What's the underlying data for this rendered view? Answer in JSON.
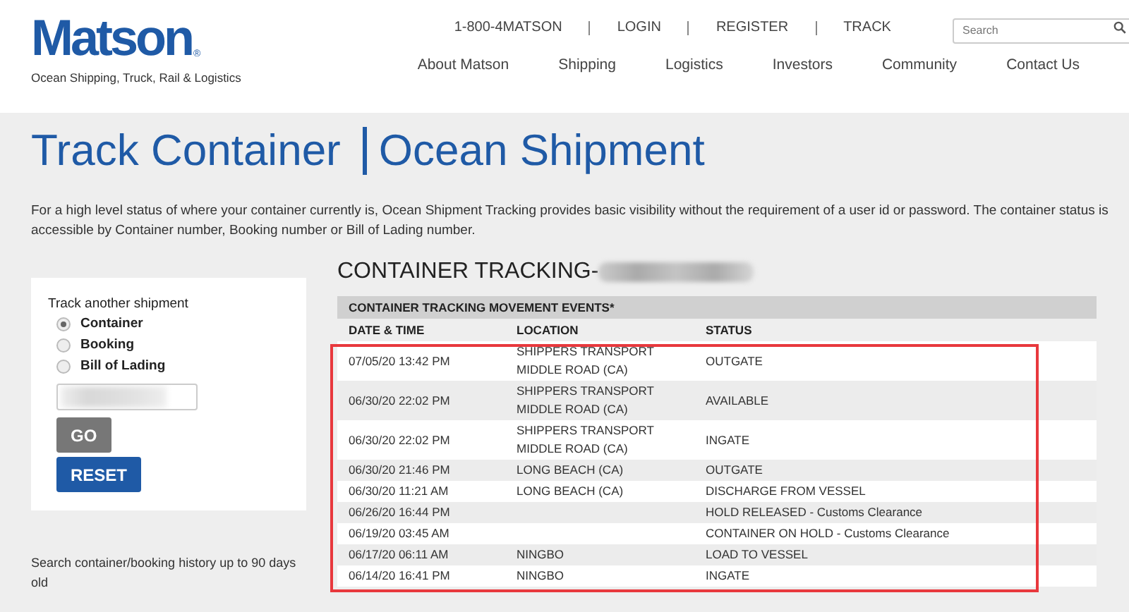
{
  "header": {
    "logo": "Matson",
    "logo_mark": "®",
    "tagline": "Ocean Shipping, Truck, Rail & Logistics",
    "top_links": [
      "1-800-4MATSON",
      "LOGIN",
      "REGISTER",
      "TRACK"
    ],
    "search": {
      "placeholder": "Search"
    },
    "nav": [
      "About Matson",
      "Shipping",
      "Logistics",
      "Investors",
      "Community",
      "Contact Us"
    ]
  },
  "page": {
    "title_left": "Track Container",
    "title_right": "Ocean Shipment",
    "intro": "For a high level status of where your container currently is, Ocean Shipment Tracking provides basic visibility without the requirement of a user id or password. The container status is accessible by Container number, Booking number or Bill of Lading number."
  },
  "tracker": {
    "title": "Track another shipment",
    "options": [
      {
        "label": "Container",
        "selected": true
      },
      {
        "label": "Booking",
        "selected": false
      },
      {
        "label": "Bill of Lading",
        "selected": false
      }
    ],
    "buttons": [
      {
        "label": "GO",
        "kind": "secondary"
      },
      {
        "label": "RESET",
        "kind": "primary"
      }
    ]
  },
  "history_note": "Search container/booking history up to 90 days old",
  "tracking": {
    "heading": "CONTAINER TRACKING-",
    "caption": "CONTAINER TRACKING  MOVEMENT EVENTS*",
    "columns": [
      "DATE & TIME",
      "LOCATION",
      "STATUS"
    ],
    "rows": [
      {
        "date": "07/05/20 13:42 PM",
        "location": "SHIPPERS TRANSPORT MIDDLE ROAD (CA)",
        "status": "OUTGATE"
      },
      {
        "date": "06/30/20 22:02 PM",
        "location": "SHIPPERS TRANSPORT MIDDLE ROAD (CA)",
        "status": "AVAILABLE"
      },
      {
        "date": "06/30/20 22:02 PM",
        "location": "SHIPPERS TRANSPORT MIDDLE ROAD (CA)",
        "status": "INGATE"
      },
      {
        "date": "06/30/20 21:46 PM",
        "location": "LONG BEACH (CA)",
        "status": "OUTGATE"
      },
      {
        "date": "06/30/20 11:21 AM",
        "location": "LONG BEACH (CA)",
        "status": "DISCHARGE FROM VESSEL"
      },
      {
        "date": "06/26/20 16:44 PM",
        "location": "",
        "status": "HOLD RELEASED - Customs Clearance"
      },
      {
        "date": "06/19/20 03:45 AM",
        "location": "",
        "status": "CONTAINER ON HOLD - Customs Clearance"
      },
      {
        "date": "06/17/20 06:11 AM",
        "location": "NINGBO",
        "status": "LOAD TO VESSEL"
      },
      {
        "date": "06/14/20 16:41 PM",
        "location": "NINGBO",
        "status": "INGATE"
      }
    ]
  }
}
